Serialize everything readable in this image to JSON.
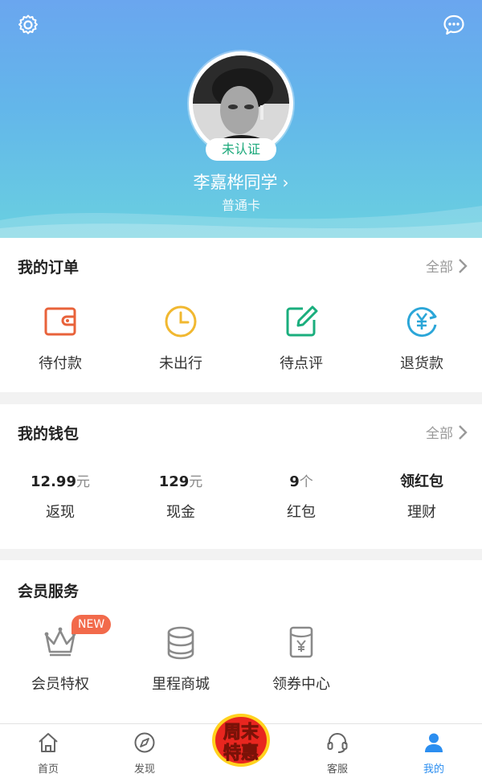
{
  "profile": {
    "verify_status": "未认证",
    "username": "李嘉桦同学",
    "card_level": "普通卡"
  },
  "orders": {
    "title": "我的订单",
    "more_label": "全部",
    "items": [
      {
        "label": "待付款",
        "icon": "wallet-icon",
        "color": "#e8623a"
      },
      {
        "label": "未出行",
        "icon": "clock-icon",
        "color": "#f1b830"
      },
      {
        "label": "待点评",
        "icon": "edit-icon",
        "color": "#1aae7d"
      },
      {
        "label": "退货款",
        "icon": "yuan-refund-icon",
        "color": "#2ba6d8"
      }
    ]
  },
  "wallet": {
    "title": "我的钱包",
    "more_label": "全部",
    "items": [
      {
        "value": "12.99",
        "unit": "元",
        "label": "返现"
      },
      {
        "value": "129",
        "unit": "元",
        "label": "现金"
      },
      {
        "value": "9",
        "unit": "个",
        "label": "红包"
      },
      {
        "value": "领红包",
        "unit": "",
        "label": "理财"
      }
    ]
  },
  "member": {
    "title": "会员服务",
    "items": [
      {
        "label": "会员特权",
        "icon": "crown-icon",
        "badge": "NEW"
      },
      {
        "label": "里程商城",
        "icon": "coins-icon"
      },
      {
        "label": "领券中心",
        "icon": "coupon-icon"
      }
    ]
  },
  "promo": {
    "line1": "周末",
    "line2": "特惠"
  },
  "tabbar": {
    "items": [
      {
        "label": "首页",
        "icon": "home-icon"
      },
      {
        "label": "发现",
        "icon": "compass-icon"
      },
      {
        "label": "客服",
        "icon": "headset-icon"
      },
      {
        "label": "我的",
        "icon": "user-icon"
      }
    ],
    "active_color": "#2b8ef0"
  },
  "colors": {
    "header_top": "#6aa6ef",
    "header_bottom": "#69d0e0",
    "verify_text": "#1aa87a",
    "new_badge": "#f26a4b"
  }
}
